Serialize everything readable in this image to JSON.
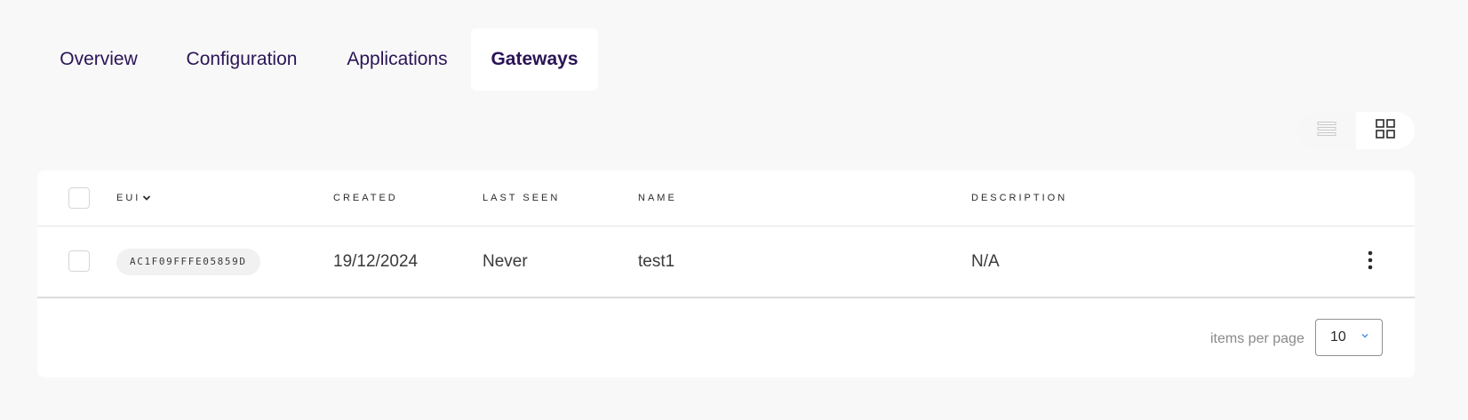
{
  "tabs": [
    {
      "label": "Overview"
    },
    {
      "label": "Configuration"
    },
    {
      "label": "Applications"
    },
    {
      "label": "Gateways",
      "active": true
    }
  ],
  "view_toggle": {
    "options": [
      "list-view-icon",
      "grid-view-icon"
    ],
    "selected": "grid-view-icon"
  },
  "table": {
    "columns": {
      "eui": "EUI",
      "created": "CREATED",
      "last_seen": "LAST SEEN",
      "name": "NAME",
      "description": "DESCRIPTION"
    },
    "sort": {
      "column": "eui",
      "icon": "chevron-down-icon"
    },
    "rows": [
      {
        "eui": "AC1F09FFFE05859D",
        "created": "19/12/2024",
        "last_seen": "Never",
        "name": "test1",
        "description": "N/A"
      }
    ]
  },
  "pagination": {
    "items_per_page_label": "items per page",
    "items_per_page": "10"
  },
  "colors": {
    "accent": "#2a1456",
    "background": "#f8f8f8",
    "card": "#ffffff",
    "chevron": "#4a90d9"
  }
}
